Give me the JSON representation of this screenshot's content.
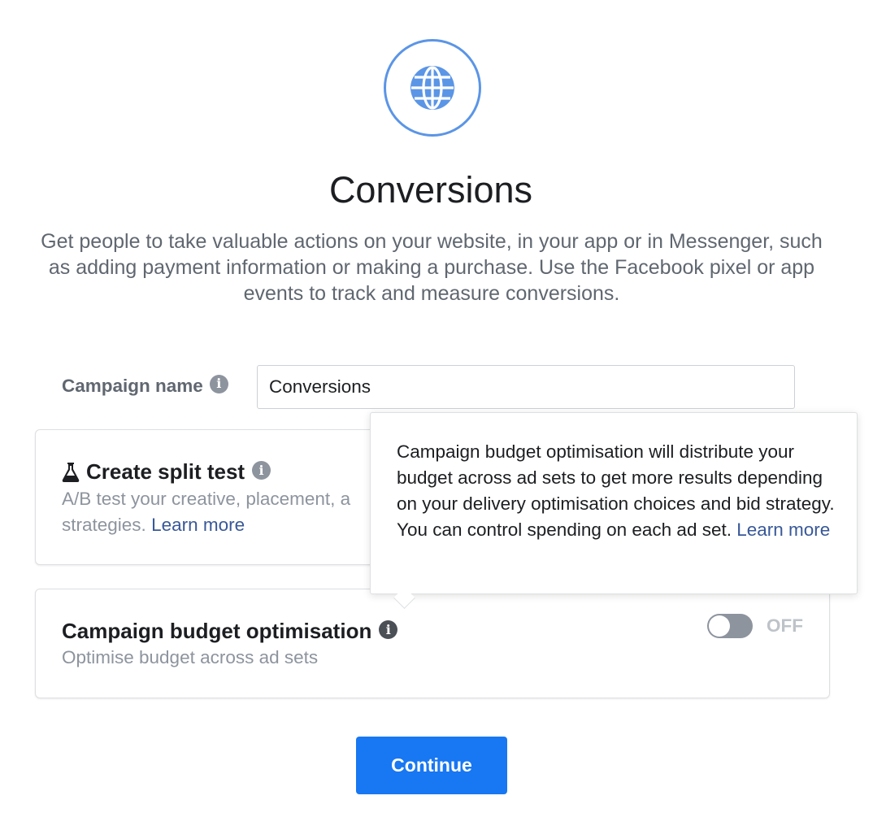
{
  "objective": {
    "icon": "globe-icon",
    "title": "Conversions",
    "description": "Get people to take valuable actions on your website, in your app or in Messenger, such as adding payment information or making a purchase. Use the Facebook pixel or app events to track and measure conversions."
  },
  "campaign_name": {
    "label": "Campaign name",
    "value": "Conversions"
  },
  "split_test": {
    "icon": "flask-icon",
    "title": "Create split test",
    "description_visible": "A/B test your creative, placement, a",
    "description_line2": "strategies.",
    "learn_more": "Learn more"
  },
  "budget_optimisation": {
    "title": "Campaign budget optimisation",
    "description": "Optimise budget across ad sets",
    "toggle_state": "OFF",
    "toggle_on": false
  },
  "tooltip": {
    "text": "Campaign budget optimisation will distribute your budget across ad sets to get more results depending on your delivery optimisation choices and bid strategy. You can control spending on each ad set.",
    "learn_more": "Learn more"
  },
  "actions": {
    "continue_label": "Continue"
  },
  "colors": {
    "primary_button": "#1877f2",
    "link": "#385898",
    "icon_ring": "#5b95e6",
    "toggle_off": "#8d949e"
  }
}
